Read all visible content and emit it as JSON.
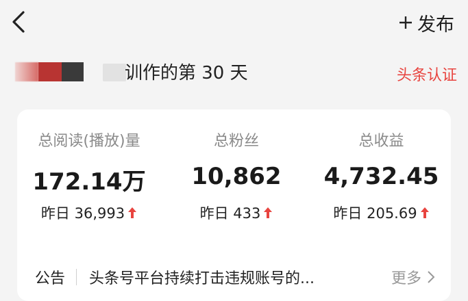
{
  "header": {
    "publish_label": "发布"
  },
  "profile": {
    "days_text": "训作的第 30 天",
    "cert_label": "头条认证"
  },
  "stats": [
    {
      "label": "总阅读(播放)量",
      "value": "172.14万",
      "yesterday": "昨日 36,993"
    },
    {
      "label": "总粉丝",
      "value": "10,862",
      "yesterday": "昨日 433"
    },
    {
      "label": "总收益",
      "value": "4,732.45",
      "yesterday": "昨日 205.69"
    }
  ],
  "notice": {
    "label": "公告",
    "text": "头条号平台持续打击违规账号的...",
    "more_label": "更多"
  },
  "colors": {
    "accent_red": "#e8443f",
    "page_bg": "#f4f4f4",
    "card_bg": "#ffffff"
  },
  "icons": [
    "chevron-left-icon",
    "plus-icon",
    "arrow-up-icon",
    "chevron-right-icon"
  ]
}
